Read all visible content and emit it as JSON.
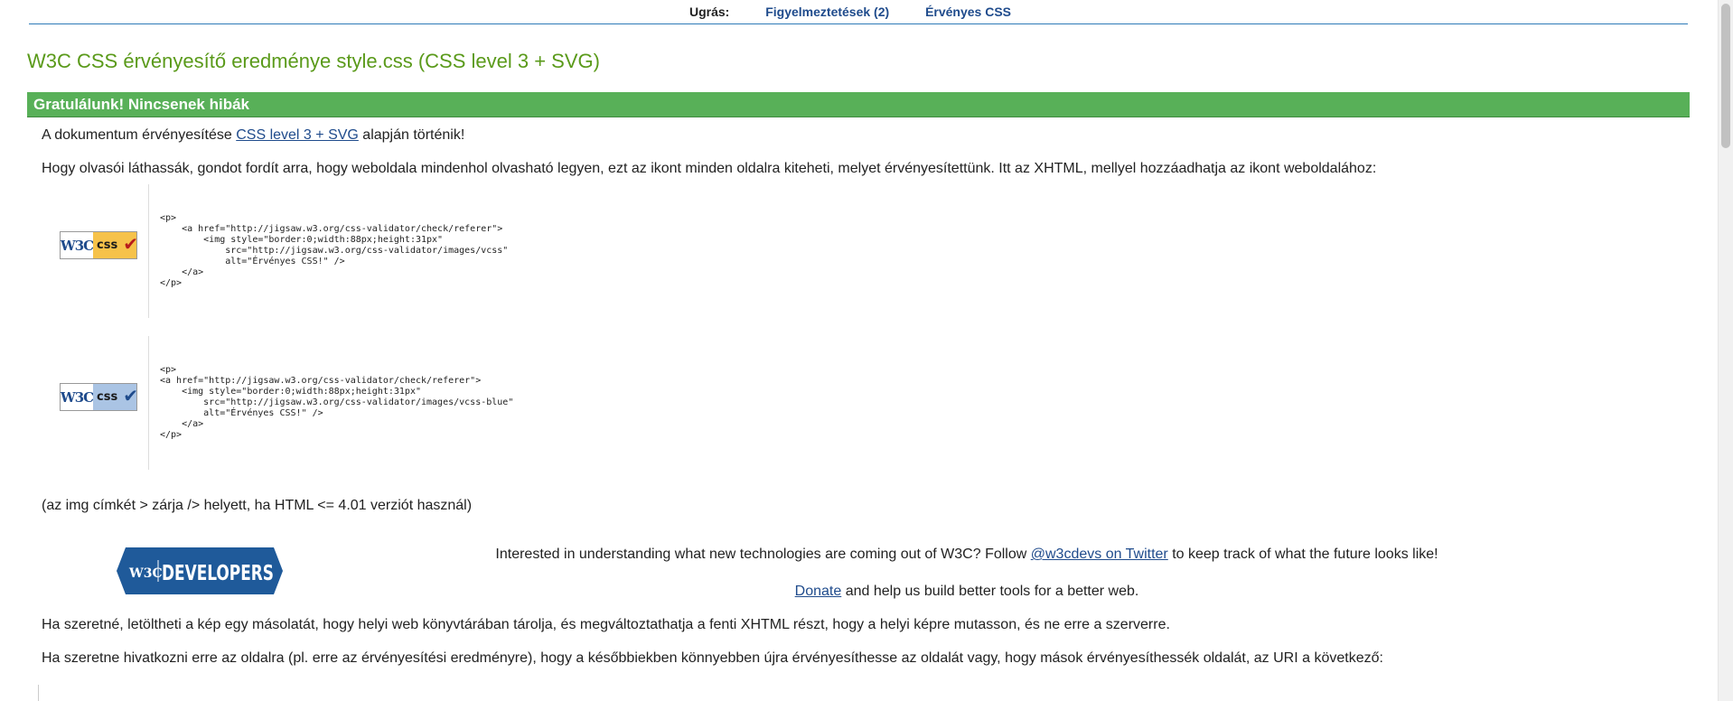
{
  "jump_nav": {
    "label": "Ugrás:",
    "links": [
      {
        "label": "Figyelmeztetések (2)"
      },
      {
        "label": "Érvényes CSS"
      }
    ]
  },
  "title": "W3C CSS érvényesítő eredménye style.css (CSS level 3 + SVG)",
  "congrats": "Gratulálunk! Nincsenek hibák",
  "validation_line": {
    "prefix": "A dokumentum érvényesítése ",
    "link": "CSS level 3 + SVG",
    "suffix": " alapján történik!"
  },
  "readers_para": "Hogy olvasói láthassák, gondot fordít arra, hogy weboldala mindenhol olvasható legyen, ezt az ikont minden oldalra kiteheti, melyet érvényesítettünk. Itt az XHTML, mellyel hozzáadhatja az ikont weboldalához:",
  "badges": [
    {
      "w3c": "W3C",
      "css": "css",
      "check": "✔",
      "color": "#f6c24a",
      "code": "<p>\n    <a href=\"http://jigsaw.w3.org/css-validator/check/referer\">\n        <img style=\"border:0;width:88px;height:31px\"\n            src=\"http://jigsaw.w3.org/css-validator/images/vcss\"\n            alt=\"Érvényes CSS!\" />\n    </a>\n</p>"
    },
    {
      "w3c": "W3C",
      "css": "css",
      "check": "✔",
      "color": "#aac4e4",
      "code": "<p>\n<a href=\"http://jigsaw.w3.org/css-validator/check/referer\">\n    <img style=\"border:0;width:88px;height:31px\"\n        src=\"http://jigsaw.w3.org/css-validator/images/vcss-blue\"\n        alt=\"Érvényes CSS!\" />\n    </a>\n</p>"
    }
  ],
  "img_note": "(az img címkét > zárja /> helyett, ha HTML <= 4.01 verziót használ)",
  "dev_logo": {
    "w3c": "W3C",
    "text": "DEVELOPERS",
    "color": "#1f5a9a"
  },
  "w3c_devs": {
    "prefix": "Interested in understanding what new technologies are coming out of W3C? Follow ",
    "link": "@w3cdevs on Twitter",
    "suffix": " to keep track of what the future looks like!"
  },
  "donate": {
    "link": "Donate",
    "suffix": " and help us build better tools for a better web."
  },
  "download_para": "Ha szeretné, letöltheti a kép egy másolatát, hogy helyi web könyvtárában tárolja, és megváltoztathatja a fenti XHTML részt, hogy a helyi képre mutasson, és ne erre a szerverre.",
  "link_para": "Ha szeretne hivatkozni erre az oldalra (pl. erre az érvényesítési eredményre), hogy a későbbiekben könnyebben újra érvényesíthesse az oldalát vagy, hogy mások érvényesíthessék oldalát, az URI a következő:"
}
